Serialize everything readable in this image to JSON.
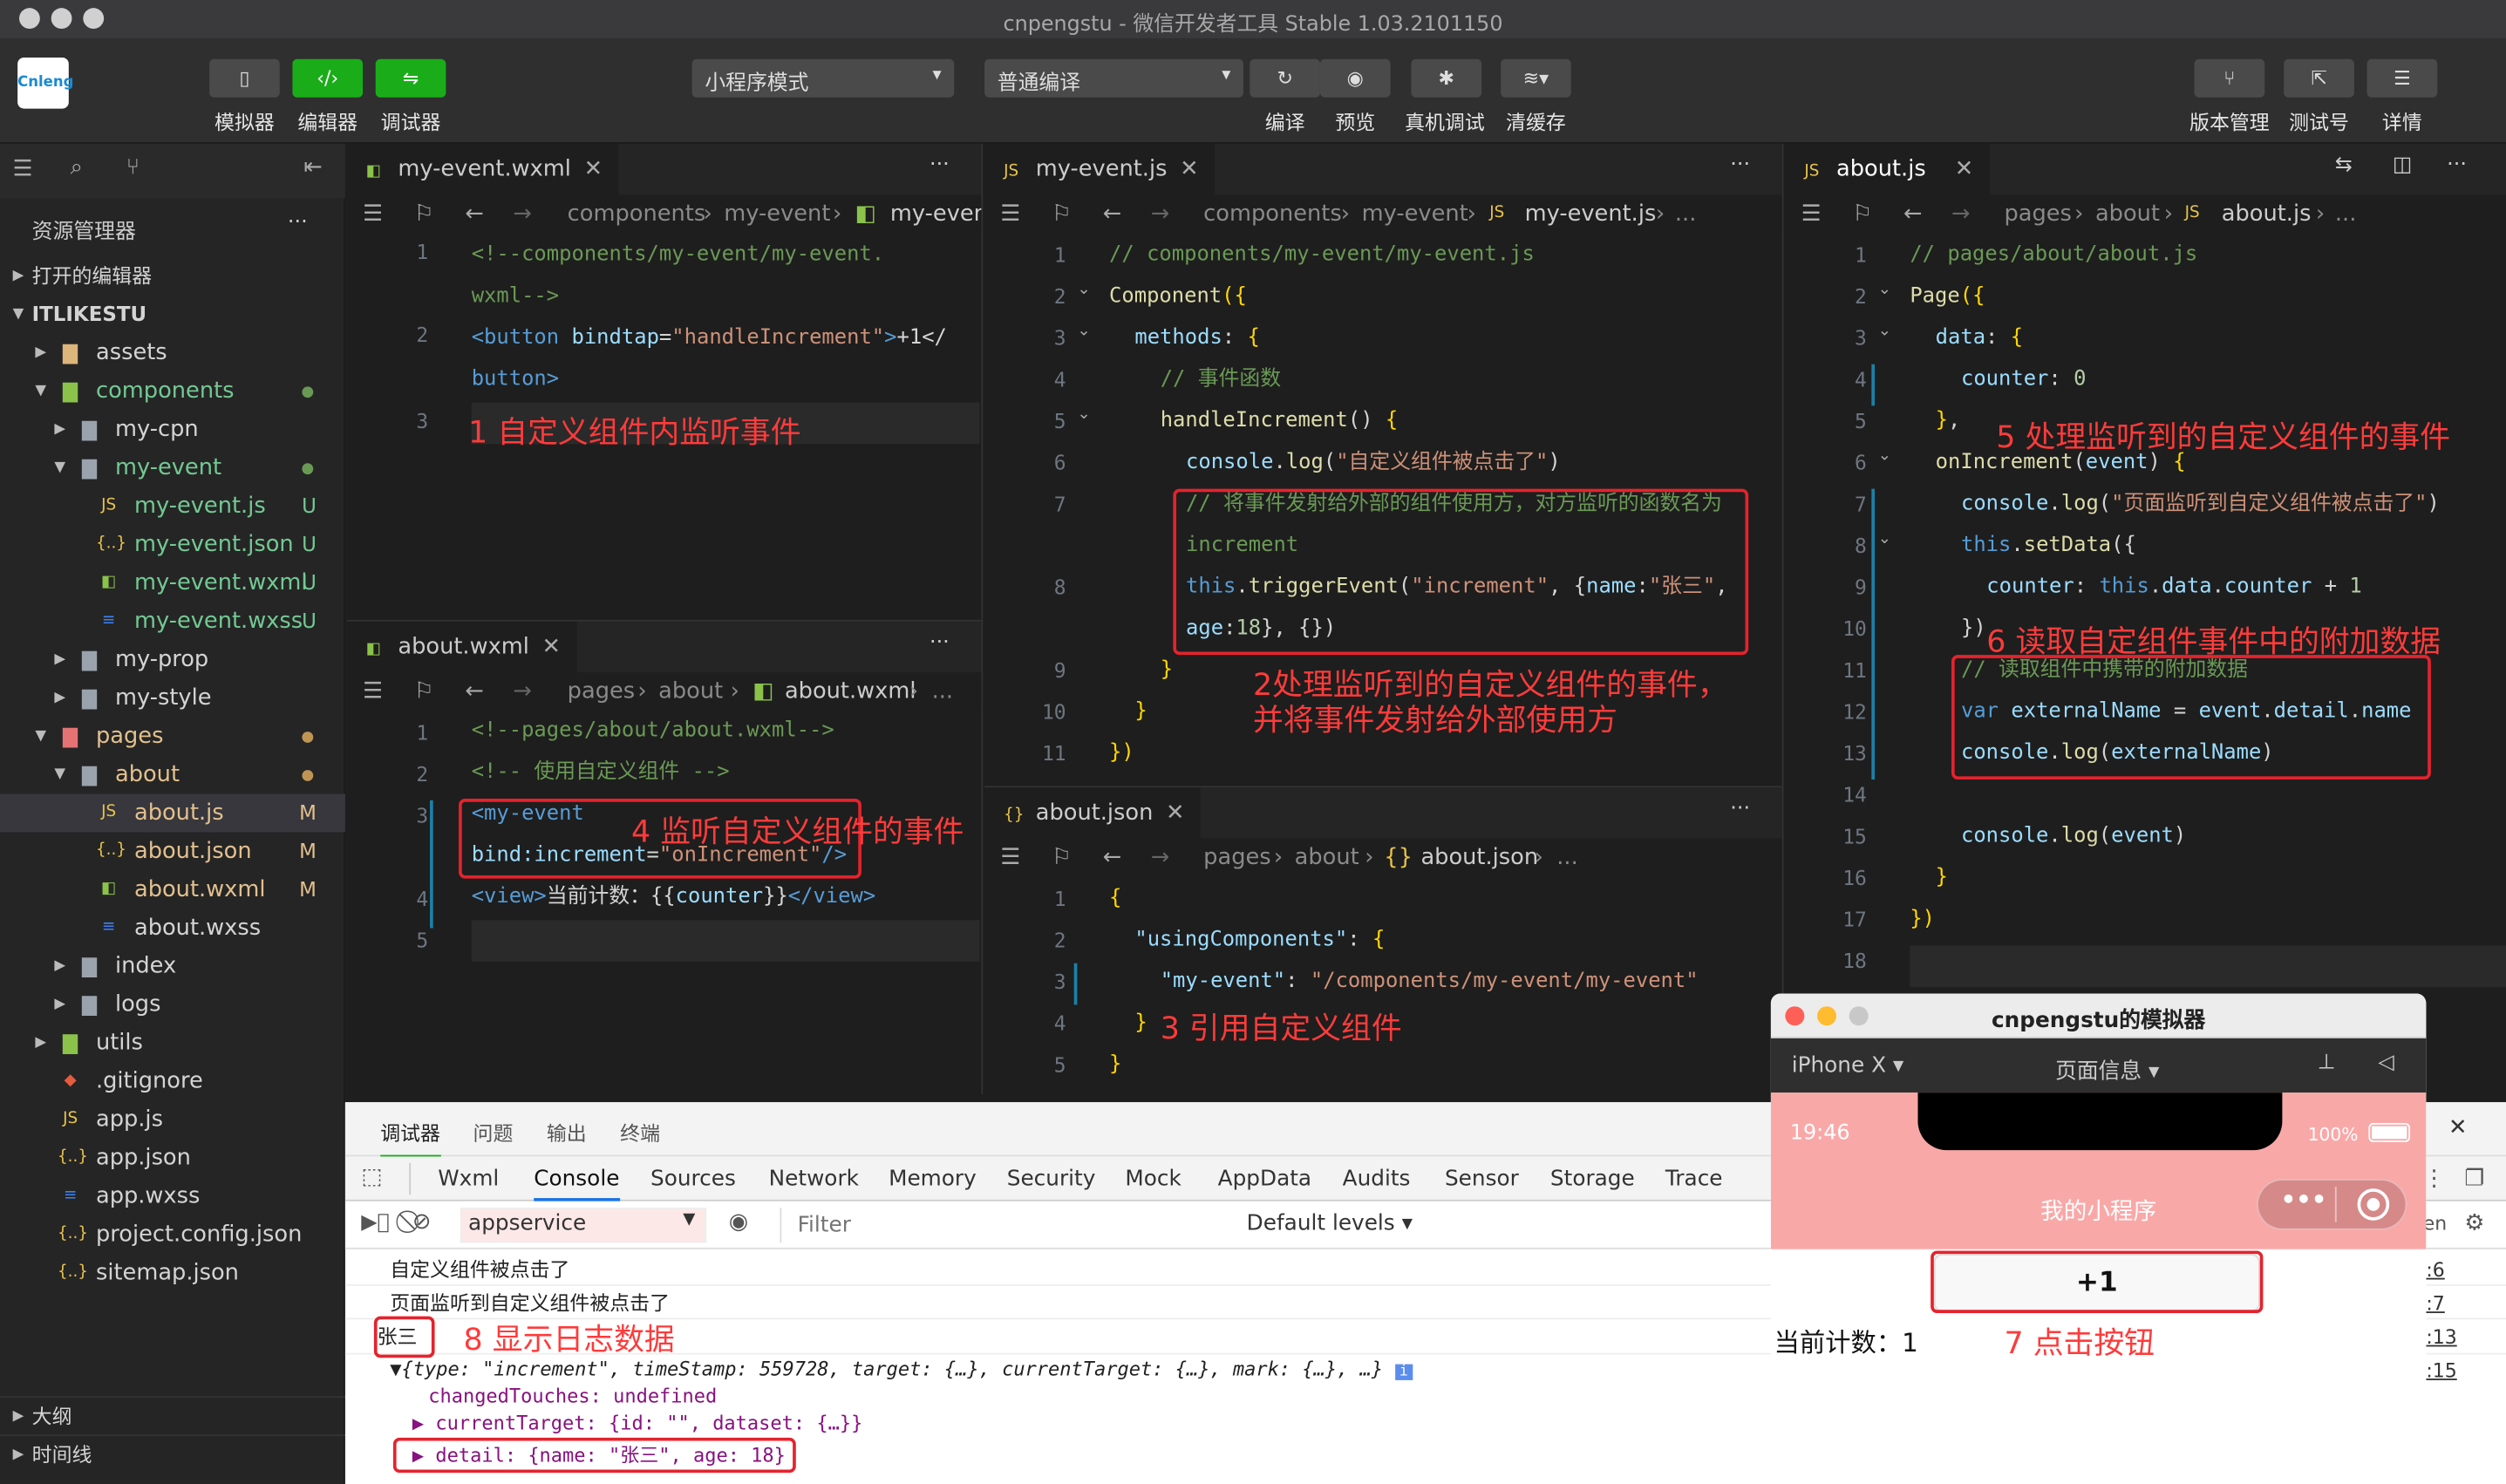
{
  "window": {
    "title": "cnpengstu - 微信开发者工具 Stable 1.03.2101150"
  },
  "toolbar": {
    "logo": "Cnleng",
    "left_buttons": [
      {
        "label": "模拟器",
        "icon": "phone-icon"
      },
      {
        "label": "编辑器",
        "icon": "code-icon"
      },
      {
        "label": "调试器",
        "icon": "sliders-icon"
      }
    ],
    "mode_select": "小程序模式",
    "compile_select": "普通编译",
    "mid_buttons": [
      {
        "label": "编译",
        "icon": "refresh-icon"
      },
      {
        "label": "预览",
        "icon": "eye-icon"
      },
      {
        "label": "真机调试",
        "icon": "bug-icon"
      },
      {
        "label": "清缓存",
        "icon": "layers-icon"
      }
    ],
    "right_buttons": [
      {
        "label": "版本管理",
        "icon": "branch-icon"
      },
      {
        "label": "测试号",
        "icon": "share-icon"
      },
      {
        "label": "详情",
        "icon": "menu-icon"
      }
    ]
  },
  "sidebar": {
    "title": "资源管理器",
    "more": "···",
    "open_editors": "打开的编辑器",
    "project": "ITLIKESTU",
    "items": [
      {
        "label": "assets",
        "depth": 1,
        "type": "folder",
        "open": false,
        "color": "#dcb67a"
      },
      {
        "label": "components",
        "depth": 1,
        "type": "folder",
        "open": true,
        "color": "#8bc34a",
        "text_color": "#73c991",
        "dot": "#6a9955"
      },
      {
        "label": "my-cpn",
        "depth": 2,
        "type": "folder",
        "open": false
      },
      {
        "label": "my-event",
        "depth": 2,
        "type": "folder",
        "open": true,
        "text_color": "#73c991",
        "dot": "#6a9955"
      },
      {
        "label": "my-event.js",
        "depth": 3,
        "type": "js",
        "badge": "U",
        "text_color": "#73c991"
      },
      {
        "label": "my-event.json",
        "depth": 3,
        "type": "json",
        "badge": "U",
        "text_color": "#73c991"
      },
      {
        "label": "my-event.wxml",
        "depth": 3,
        "type": "wxml",
        "badge": "U",
        "text_color": "#73c991"
      },
      {
        "label": "my-event.wxss",
        "depth": 3,
        "type": "wxss",
        "badge": "U",
        "text_color": "#73c991"
      },
      {
        "label": "my-prop",
        "depth": 2,
        "type": "folder",
        "open": false
      },
      {
        "label": "my-style",
        "depth": 2,
        "type": "folder",
        "open": false
      },
      {
        "label": "pages",
        "depth": 1,
        "type": "folder",
        "open": true,
        "color": "#e57373",
        "text_color": "#e2c08d",
        "dot": "#c09553"
      },
      {
        "label": "about",
        "depth": 2,
        "type": "folder",
        "open": true,
        "text_color": "#e2c08d",
        "dot": "#c09553"
      },
      {
        "label": "about.js",
        "depth": 3,
        "type": "js",
        "badge": "M",
        "text_color": "#e2c08d",
        "selected": true
      },
      {
        "label": "about.json",
        "depth": 3,
        "type": "json",
        "badge": "M",
        "text_color": "#e2c08d"
      },
      {
        "label": "about.wxml",
        "depth": 3,
        "type": "wxml",
        "badge": "M",
        "text_color": "#e2c08d"
      },
      {
        "label": "about.wxss",
        "depth": 3,
        "type": "wxss"
      },
      {
        "label": "index",
        "depth": 2,
        "type": "folder",
        "open": false
      },
      {
        "label": "logs",
        "depth": 2,
        "type": "folder",
        "open": false
      },
      {
        "label": "utils",
        "depth": 1,
        "type": "folder",
        "open": false,
        "color": "#8bc34a"
      },
      {
        "label": ".gitignore",
        "depth": 1,
        "type": "git"
      },
      {
        "label": "app.js",
        "depth": 1,
        "type": "js"
      },
      {
        "label": "app.json",
        "depth": 1,
        "type": "json"
      },
      {
        "label": "app.wxss",
        "depth": 1,
        "type": "wxss"
      },
      {
        "label": "project.config.json",
        "depth": 1,
        "type": "json"
      },
      {
        "label": "sitemap.json",
        "depth": 1,
        "type": "json"
      }
    ],
    "outline": "大纲",
    "timeline": "时间线"
  },
  "editors": {
    "wxml_event": {
      "tab": "my-event.wxml",
      "crumb": [
        "components",
        "my-event",
        "my-event"
      ],
      "lines": [
        "1",
        "2",
        "3"
      ]
    },
    "wxml_about": {
      "tab": "about.wxml",
      "crumb": [
        "pages",
        "about",
        "about.wxml",
        "..."
      ],
      "lines": [
        "1",
        "2",
        "3",
        "4",
        "5"
      ]
    },
    "js_event": {
      "tab": "my-event.js",
      "crumb": [
        "components",
        "my-event",
        "my-event.js",
        "..."
      ],
      "lines": [
        "1",
        "2",
        "3",
        "4",
        "5",
        "6",
        "7",
        "8",
        "9",
        "10",
        "11"
      ]
    },
    "json_about": {
      "tab": "about.json",
      "crumb": [
        "pages",
        "about",
        "about.json",
        "..."
      ],
      "lines": [
        "1",
        "2",
        "3",
        "4",
        "5"
      ]
    },
    "js_about": {
      "tab": "about.js",
      "crumb": [
        "pages",
        "about",
        "about.js",
        "..."
      ],
      "lines": [
        "1",
        "2",
        "3",
        "4",
        "5",
        "6",
        "7",
        "8",
        "9",
        "10",
        "11",
        "12",
        "13",
        "14",
        "15",
        "16",
        "17",
        "18"
      ]
    }
  },
  "annotations": {
    "a1": "1 自定义组件内监听事件",
    "a2": "2处理监听到的自定义组件的事件，\n并将事件发射给外部使用方",
    "a3": "3 引用自定义组件",
    "a4": "4 监听自定义组件的事件",
    "a5": "5 处理监听到的自定义组件的事件",
    "a6": "6 读取自定组件事件中的附加数据",
    "a7": "7 点击按钮",
    "a8": "8 显示日志数据"
  },
  "devtools": {
    "top_tabs": [
      "调试器",
      "问题",
      "输出",
      "终端"
    ],
    "tabs": [
      "Wxml",
      "Console",
      "Sources",
      "Network",
      "Memory",
      "Security",
      "Mock",
      "AppData",
      "Audits",
      "Sensor",
      "Storage",
      "Trace"
    ],
    "context": "appservice",
    "filter_placeholder": "Filter",
    "levels": "Default levels",
    "log1": "自定义组件被点击了",
    "log2": "页面监听到自定义组件被点击了",
    "log3": "张三",
    "obj_line": "{type: \"increment\", timeStamp: 559728, target: {…}, currentTarget: {…}, mark: {…}, …}",
    "changed": "changedTouches: undefined",
    "current_target": "currentTarget: {id: \"\", dataset: {…}}",
    "detail": "detail: {name: \"张三\", age: 18}",
    "refs": [
      ":6",
      ":7",
      ":13",
      ":15"
    ]
  },
  "simulator": {
    "title": "cnpengstu的模拟器",
    "device": "iPhone X",
    "page_info": "页面信息",
    "time": "19:46",
    "battery": "100%",
    "nav_title": "我的小程序",
    "button": "+1",
    "counter": "当前计数：1"
  }
}
